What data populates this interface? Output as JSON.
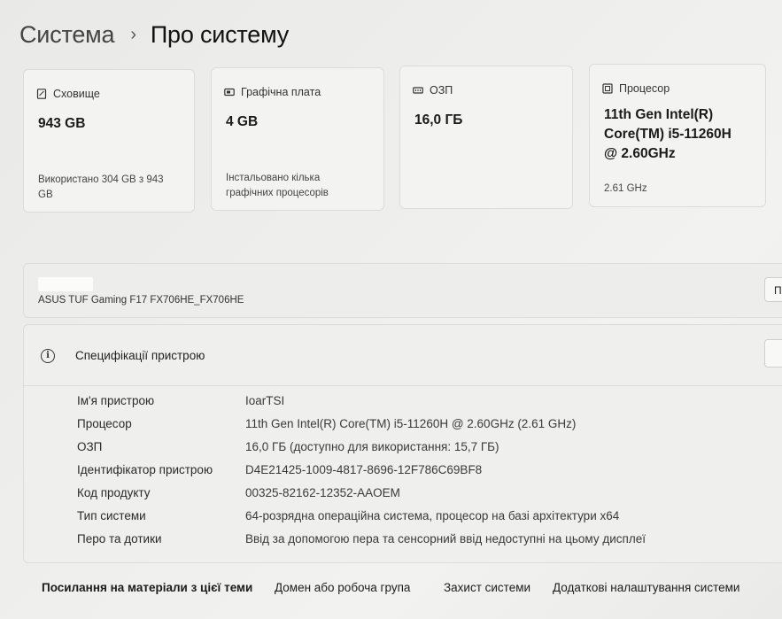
{
  "breadcrumb": {
    "parent": "Система",
    "separator": "›",
    "current": "Про систему"
  },
  "cards": {
    "storage": {
      "icon": "storage-icon",
      "title": "Сховище",
      "value": "943 GB",
      "sub_line1": "Використано 304 GB з 943",
      "sub_line2": "GB"
    },
    "gpu": {
      "icon": "graphics-card-icon",
      "title": "Графічна плата",
      "value": "4 GB",
      "sub_line1": "Інстальовано кілька",
      "sub_line2": "графічних процесорів"
    },
    "ram": {
      "icon": "ram-icon",
      "title": "ОЗП",
      "value": "16,0 ГБ"
    },
    "cpu": {
      "icon": "processor-icon",
      "title": "Процесор",
      "value_line1": "11th Gen Intel(R)",
      "value_line2": "Core(TM) i5-11260H",
      "value_line3": "@ 2.60GHz",
      "sub": "2.61 GHz"
    }
  },
  "device": {
    "model": "ASUS TUF Gaming F17 FX706HE_FX706HE",
    "rename_label": "П"
  },
  "specs": {
    "title": "Специфікації пристрою",
    "rows": [
      {
        "key": "Ім'я пристрою",
        "value": "IoarTSI"
      },
      {
        "key": "Процесор",
        "value": "11th Gen Intel(R) Core(TM) i5-11260H @ 2.60GHz (2.61 GHz)"
      },
      {
        "key": "ОЗП",
        "value": "16,0 ГБ (доступно для використання: 15,7 ГБ)"
      },
      {
        "key": "Ідентифікатор пристрою",
        "value": "D4E21425-1009-4817-8696-12F786C69BF8"
      },
      {
        "key": "Код продукту",
        "value": "00325-82162-12352-AAOEM"
      },
      {
        "key": "Тип системи",
        "value": "64-розрядна операційна система, процесор на базі архітектури x64"
      },
      {
        "key": "Перо та дотики",
        "value": "Ввід за допомогою пера та сенсорний ввід недоступні на цьому дисплеї"
      }
    ]
  },
  "related_links": {
    "label": "Посилання на матеріали з цієї теми",
    "items": [
      "Домен або робоча група",
      "Захист системи",
      "Додаткові налаштування системи"
    ]
  }
}
